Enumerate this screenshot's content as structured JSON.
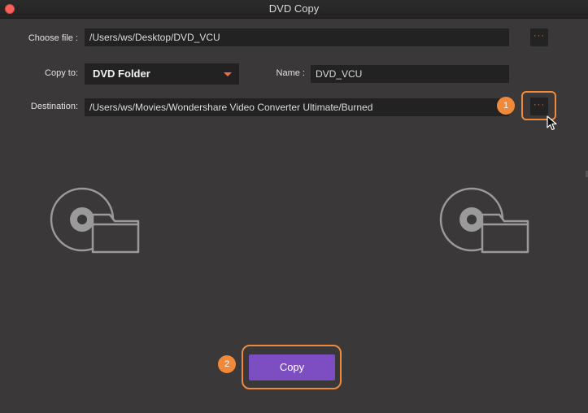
{
  "window": {
    "title": "DVD Copy"
  },
  "choose_file": {
    "label": "Choose file :",
    "value": "/Users/ws/Desktop/DVD_VCU",
    "browse_label": "···"
  },
  "copy_to": {
    "label": "Copy to:",
    "selected": "DVD Folder"
  },
  "name": {
    "label": "Name :",
    "value": "DVD_VCU"
  },
  "destination": {
    "label": "Destination:",
    "value": "/Users/ws/Movies/Wondershare Video Converter Ultimate/Burned",
    "browse_label": "···"
  },
  "annotations": {
    "step1": "1",
    "step2": "2"
  },
  "actions": {
    "copy_label": "Copy"
  },
  "icons": {
    "source": "disc-folder-icon",
    "target": "disc-folder-icon",
    "dropdown_arrow": "caret-down-icon",
    "cursor": "mouse-pointer-icon"
  },
  "colors": {
    "accent": "#f08a3a",
    "button": "#7d4dc2",
    "dots": "#e9734a"
  }
}
